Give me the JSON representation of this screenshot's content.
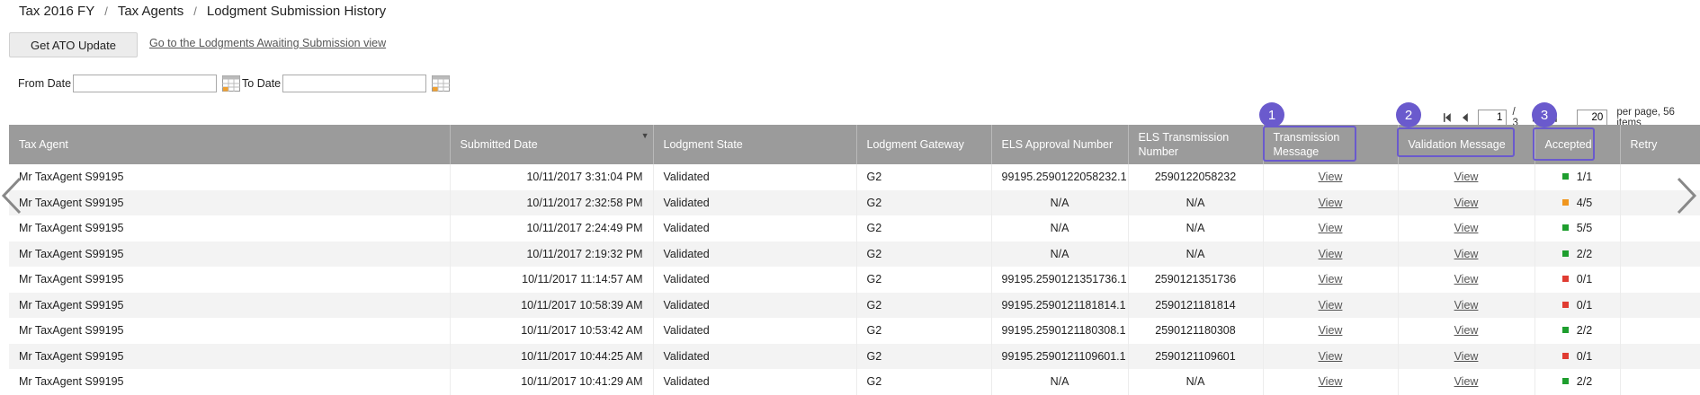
{
  "breadcrumb": [
    "Tax 2016 FY",
    "Tax Agents",
    "Lodgment Submission History"
  ],
  "toolbar": {
    "ato_label": "Get ATO Update",
    "awaiting_link": "Go to the Lodgments Awaiting Submission view"
  },
  "filters": {
    "from_label": "From Date",
    "to_label": "To Date",
    "from_value": "",
    "to_value": ""
  },
  "pager": {
    "current_page": "1",
    "total_pages_text": "/ 3",
    "per_page": "20",
    "per_page_text": "per page, 56 items"
  },
  "columns": [
    "Tax Agent",
    "Submitted Date",
    "Lodgment State",
    "Lodgment Gateway",
    "ELS Approval Number",
    "ELS Transmission Number",
    "Transmission Message",
    "Validation Message",
    "Accepted",
    "Retry"
  ],
  "view_label": "View",
  "status_colors": {
    "green": "#1e9e2e",
    "orange": "#f0961e",
    "red": "#e03c32"
  },
  "rows": [
    {
      "agent": "Mr TaxAgent S99195",
      "date": "10/11/2017 3:31:04 PM",
      "state": "Validated",
      "gateway": "G2",
      "approval": "99195.2590122058232.1",
      "transmission": "2590122058232",
      "accepted": "1/1",
      "status": "green"
    },
    {
      "agent": "Mr TaxAgent S99195",
      "date": "10/11/2017 2:32:58 PM",
      "state": "Validated",
      "gateway": "G2",
      "approval": "N/A",
      "transmission": "N/A",
      "accepted": "4/5",
      "status": "orange"
    },
    {
      "agent": "Mr TaxAgent S99195",
      "date": "10/11/2017 2:24:49 PM",
      "state": "Validated",
      "gateway": "G2",
      "approval": "N/A",
      "transmission": "N/A",
      "accepted": "5/5",
      "status": "green"
    },
    {
      "agent": "Mr TaxAgent S99195",
      "date": "10/11/2017 2:19:32 PM",
      "state": "Validated",
      "gateway": "G2",
      "approval": "N/A",
      "transmission": "N/A",
      "accepted": "2/2",
      "status": "green"
    },
    {
      "agent": "Mr TaxAgent S99195",
      "date": "10/11/2017 11:14:57 AM",
      "state": "Validated",
      "gateway": "G2",
      "approval": "99195.2590121351736.1",
      "transmission": "2590121351736",
      "accepted": "0/1",
      "status": "red"
    },
    {
      "agent": "Mr TaxAgent S99195",
      "date": "10/11/2017 10:58:39 AM",
      "state": "Validated",
      "gateway": "G2",
      "approval": "99195.2590121181814.1",
      "transmission": "2590121181814",
      "accepted": "0/1",
      "status": "red"
    },
    {
      "agent": "Mr TaxAgent S99195",
      "date": "10/11/2017 10:53:42 AM",
      "state": "Validated",
      "gateway": "G2",
      "approval": "99195.2590121180308.1",
      "transmission": "2590121180308",
      "accepted": "2/2",
      "status": "green"
    },
    {
      "agent": "Mr TaxAgent S99195",
      "date": "10/11/2017 10:44:25 AM",
      "state": "Validated",
      "gateway": "G2",
      "approval": "99195.2590121109601.1",
      "transmission": "2590121109601",
      "accepted": "0/1",
      "status": "red"
    },
    {
      "agent": "Mr TaxAgent S99195",
      "date": "10/11/2017 10:41:29 AM",
      "state": "Validated",
      "gateway": "G2",
      "approval": "N/A",
      "transmission": "N/A",
      "accepted": "2/2",
      "status": "green"
    }
  ],
  "callouts": [
    "1",
    "2",
    "3"
  ]
}
